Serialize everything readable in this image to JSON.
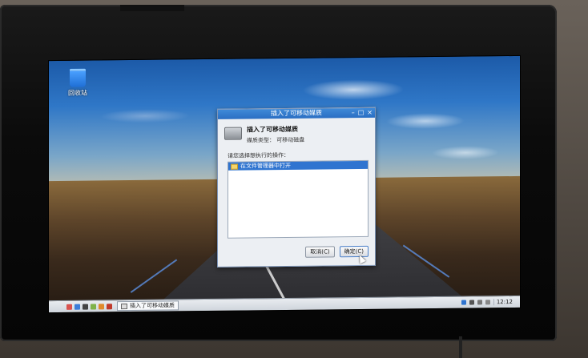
{
  "desktop": {
    "icons": [
      {
        "label": "回收站",
        "icon": "trash-icon"
      }
    ]
  },
  "dialog": {
    "title": "插入了可移动媒质",
    "titlebar_buttons": [
      "–",
      "□",
      "×"
    ],
    "heading": "插入了可移动媒质",
    "type_label": "媒质类型：",
    "type_value": "可移动磁盘",
    "prompt": "请您选择想执行的操作：",
    "actions": [
      {
        "label": "在文件管理器中打开",
        "selected": true,
        "icon": "folder-icon"
      }
    ],
    "buttons": {
      "cancel": "取消(C)",
      "ok": "确定(C)"
    }
  },
  "taskbar": {
    "launcher_icons": [
      "menu-icon",
      "file-manager-icon",
      "terminal-icon",
      "editor-icon",
      "browser-icon",
      "settings-icon"
    ],
    "active_window": "插入了可移动媒质",
    "clock": "12:12",
    "tray_icons": [
      "bluetooth-icon",
      "volume-icon",
      "usb-icon",
      "network-icon"
    ]
  },
  "colors": {
    "titlebar": "#2a6ec3",
    "selection": "#2f74d0",
    "taskbar": "#dfe3e8"
  }
}
